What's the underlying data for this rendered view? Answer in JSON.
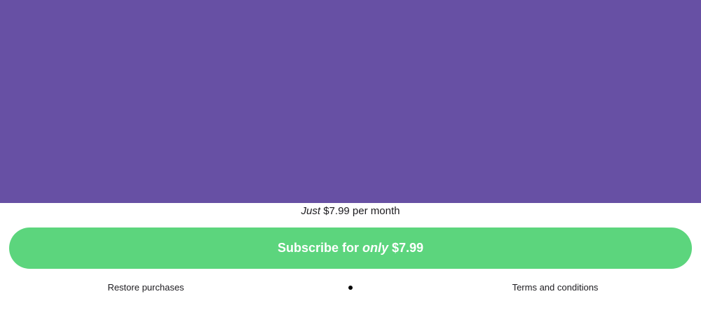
{
  "hero": {
    "background_color": "#6750A4"
  },
  "pricing": {
    "prefix_italic": "Just",
    "price_text": " $7.99 per month"
  },
  "subscribe_button": {
    "label_start": "Subscribe for ",
    "label_italic": "only",
    "label_end": " $7.99",
    "color": "#5CD57D"
  },
  "footer": {
    "restore_label": "Restore purchases",
    "separator": "•",
    "terms_label": "Terms and conditions"
  }
}
